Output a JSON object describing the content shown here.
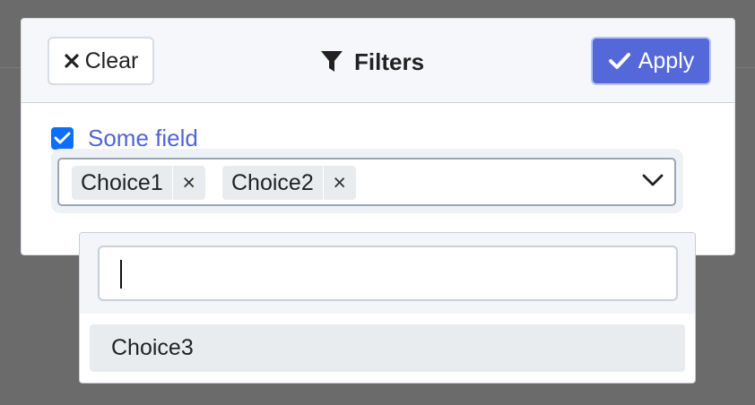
{
  "header": {
    "clear_label": "Clear",
    "title": "Filters",
    "apply_label": "Apply"
  },
  "field": {
    "label": "Some field",
    "checked": true
  },
  "select": {
    "selected": [
      {
        "label": "Choice1",
        "remove": "×"
      },
      {
        "label": "Choice2",
        "remove": "×"
      }
    ]
  },
  "dropdown": {
    "search_value": "",
    "options": [
      {
        "label": "Choice3"
      }
    ]
  },
  "colors": {
    "accent": "#5568d9",
    "checkbox": "#0d6efd",
    "field_label": "#5265d6"
  },
  "icons": {
    "clear": "times-icon",
    "title": "filter-icon",
    "apply": "check-icon",
    "select": "chevron-down-icon"
  }
}
